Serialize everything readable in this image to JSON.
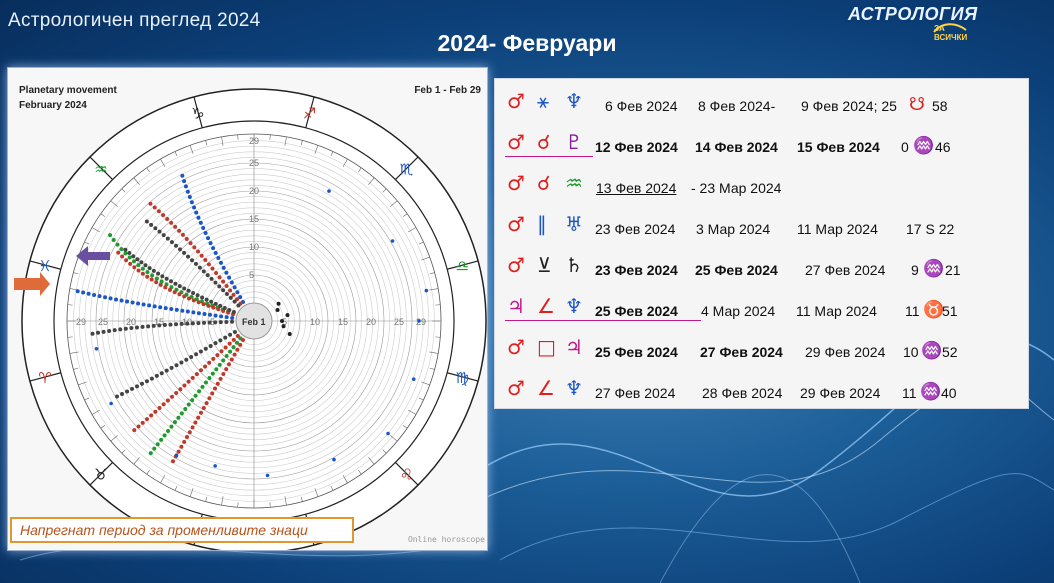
{
  "header": {
    "top_title": "Астрологичен преглед 2024",
    "main_title": "2024- Февруари",
    "logo_text": "АСТРОЛОГИЯ",
    "logo_sub": "ЗА ВСИЧКИ"
  },
  "chart": {
    "title": "Planetary movement",
    "subtitle": "February 2024",
    "range": "Feb 1 - Feb 29",
    "center_label": "Feb 1",
    "credit": "Online horoscope",
    "caption": "Напрегнат период за променливите знаци",
    "ring_labels_vertical": [
      "29",
      "25",
      "20",
      "15",
      "10",
      "5"
    ],
    "ring_labels_horizontal": [
      "29",
      "25",
      "20",
      "15",
      "10",
      "5",
      "5",
      "10",
      "15",
      "20",
      "25",
      "29"
    ]
  },
  "colors": {
    "red": "#e01e1e",
    "green": "#1f9a2e",
    "blue": "#1a56c9",
    "purple": "#8a1f9a",
    "magenta": "#c2188b",
    "caption_border": "#e0972f"
  },
  "aspects": [
    {
      "glyphs": [
        "mars-icon",
        "sextile-icon",
        "neptune-icon"
      ],
      "g1": "♂",
      "g2": "⚹",
      "g3": "♆",
      "cols": [
        "6 Фев 2024",
        "8 Фев 2024-",
        "9 Фев 2024; 25",
        "☋",
        "58"
      ]
    },
    {
      "glyphs": [
        "mars-icon",
        "conjunction-icon",
        "pluto-icon"
      ],
      "g1": "♂",
      "g2": "☌",
      "g3": "♇",
      "cols": [
        "12 Фев 2024",
        "14 Фев 2024",
        "15 Фев 2024",
        "0",
        "♒",
        "46"
      ]
    },
    {
      "glyphs": [
        "mars-icon",
        "conjunction-icon",
        "aquarius-icon"
      ],
      "g1": "♂",
      "g2": "☌",
      "g3": "♒",
      "cols": [
        "13 Фев 2024",
        " -  23 Мар 2024"
      ]
    },
    {
      "glyphs": [
        "mars-icon",
        "parallel-icon",
        "uranus-icon"
      ],
      "g1": "♂",
      "g2": "∥",
      "g3": "♅",
      "cols": [
        "23 Фев 2024",
        "3 Мар 2024",
        "11 Мар 2024",
        "17 S 22"
      ]
    },
    {
      "glyphs": [
        "mars-icon",
        "semisextile-icon",
        "saturn-icon"
      ],
      "g1": "♂",
      "g2": "⊻",
      "g3": "♄",
      "cols": [
        "23 Фев 2024",
        "25 Фев 2024",
        "27 Фев 2024",
        "9",
        "♒",
        "21"
      ]
    },
    {
      "glyphs": [
        "jupiter-icon",
        "semisquare-icon",
        "neptune-icon"
      ],
      "g1": "♃",
      "g2": "∠",
      "g3": "♆",
      "cols": [
        "25 Фев 2024",
        "4 Мар 2024",
        "11 Мар 2024",
        "11",
        "♉",
        "51"
      ]
    },
    {
      "glyphs": [
        "mars-icon",
        "square-icon",
        "jupiter-icon"
      ],
      "g1": "♂",
      "g2": "□",
      "g3": "♃",
      "cols": [
        "25 Фев 2024",
        "27 Фев 2024",
        "29 Фев 2024",
        "10",
        "♒",
        "52"
      ]
    },
    {
      "glyphs": [
        "mars-icon",
        "semisquare-icon",
        "neptune-icon"
      ],
      "g1": "♂",
      "g2": "∠",
      "g3": "♆",
      "cols": [
        "27 Фев 2024",
        "28 Фев 2024",
        "29 Фев 2024",
        "11",
        "♒",
        "40"
      ]
    }
  ]
}
